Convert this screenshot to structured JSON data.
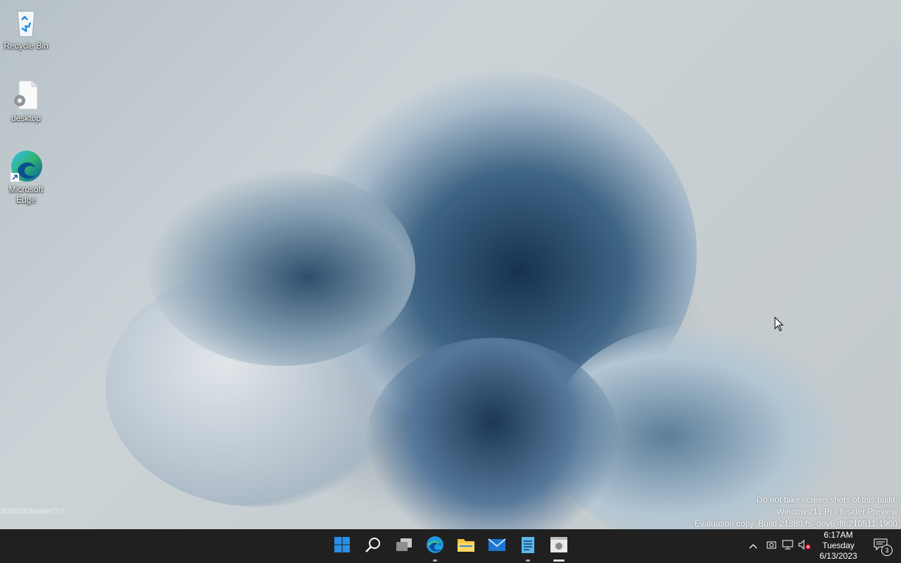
{
  "desktop": {
    "icons": [
      {
        "label": "Recycle Bin"
      },
      {
        "label": "desktop"
      },
      {
        "label": "Microsoft Edge"
      }
    ],
    "watermark": {
      "line1": "Do not take screen shots of this build.",
      "line2": "Windows 11 Pro Insider Preview",
      "line3": "Evaluation copy. Build 21380.fs_dev6_flt.210511-1900"
    },
    "hash_text": "3cf4b3f06ed6e757"
  },
  "taskbar": {
    "apps": [
      {
        "name": "start-icon"
      },
      {
        "name": "search-icon"
      },
      {
        "name": "task-view-icon"
      },
      {
        "name": "edge-icon",
        "running": true
      },
      {
        "name": "file-explorer-icon"
      },
      {
        "name": "mail-icon"
      },
      {
        "name": "notepad-icon",
        "running": true
      },
      {
        "name": "app-icon",
        "running": true,
        "active": true
      }
    ],
    "clock": {
      "time": "6:17AM",
      "day": "Tuesday",
      "date": "6/13/2023"
    },
    "notifications": {
      "count": "3"
    }
  },
  "colors": {
    "taskbar": "#202020",
    "start_blue": "#0078d4",
    "folder_yellow": "#f7c843"
  }
}
